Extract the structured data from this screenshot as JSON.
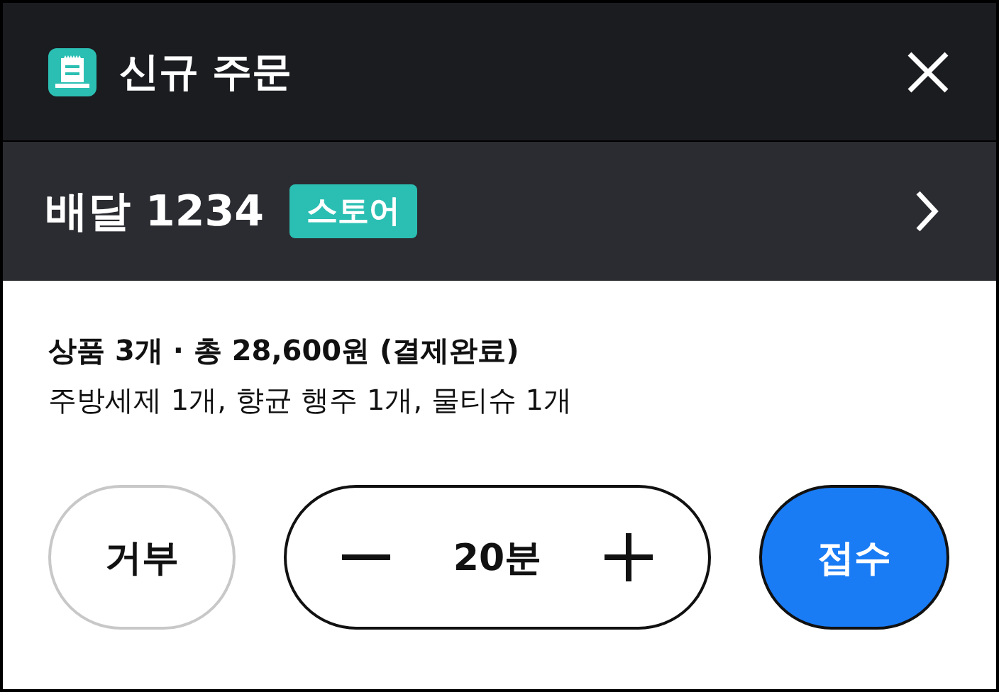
{
  "window": {
    "title": "신규 주문"
  },
  "order": {
    "label": "배달 1234",
    "tag": "스토어"
  },
  "summary": {
    "headline": "상품 3개 · 총 28,600원 (결제완료)",
    "items": "주방세제 1개, 향균 행주 1개, 물티슈 1개"
  },
  "actions": {
    "reject": "거부",
    "time": "20분",
    "accept": "접수"
  }
}
